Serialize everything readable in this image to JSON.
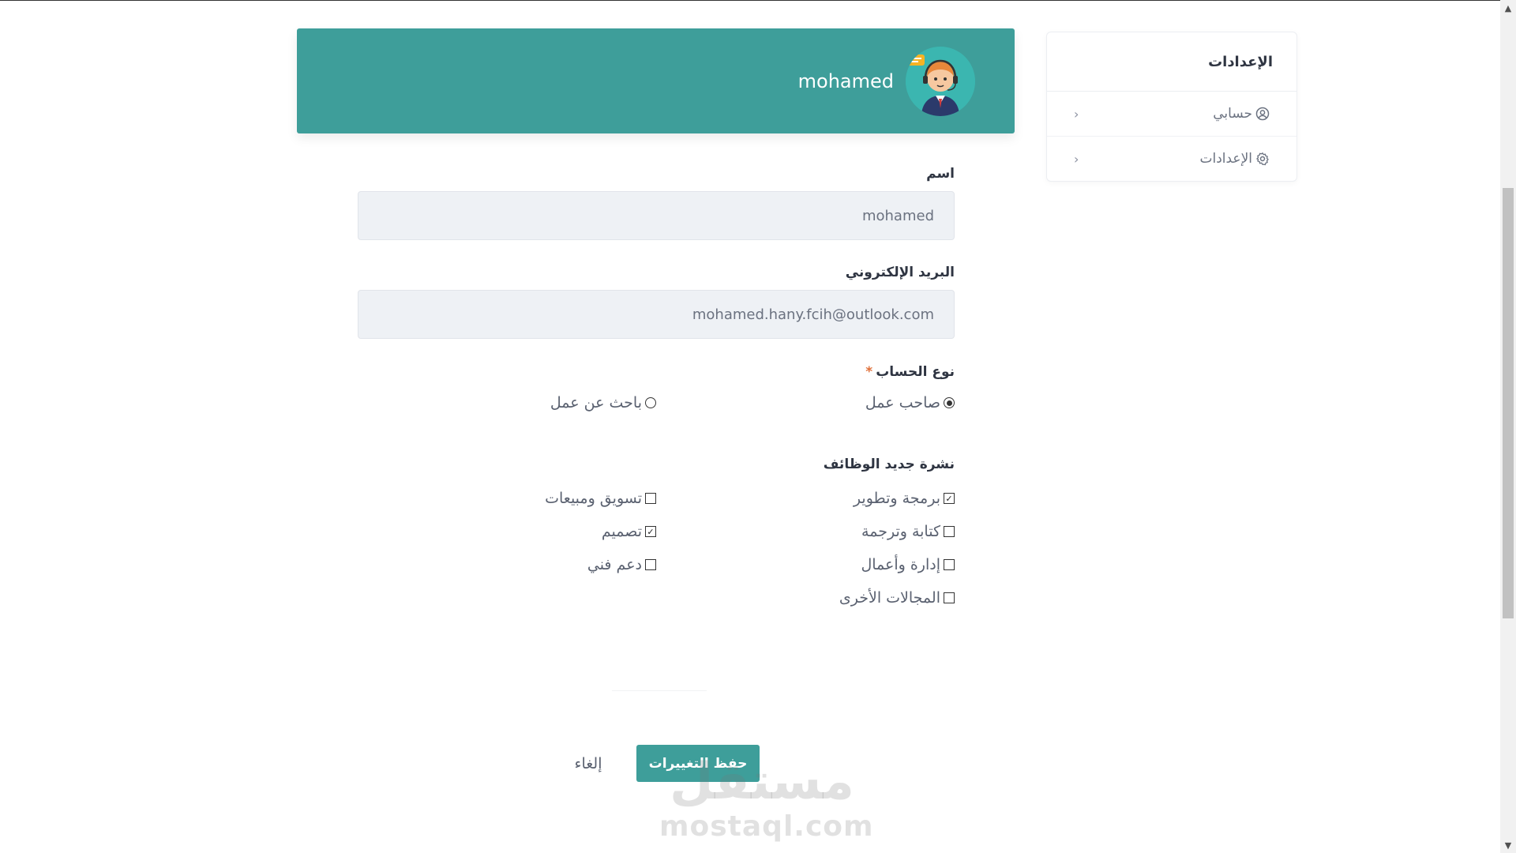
{
  "sidebar": {
    "title": "الإعدادات",
    "items": [
      {
        "label": "حسابي",
        "icon": "user-circle-icon"
      },
      {
        "label": "الإعدادات",
        "icon": "gear-icon"
      }
    ]
  },
  "profile": {
    "name": "mohamed",
    "avatar": "support-agent-avatar"
  },
  "form": {
    "name_label": "اسم",
    "name_value": "mohamed",
    "email_label": "البريد الإلكتروني",
    "email_value": "mohamed.hany.fcih@outlook.com",
    "account_type_label": "نوع الحساب",
    "required_mark": "*",
    "account_types": [
      {
        "label": "صاحب عمل",
        "selected": true
      },
      {
        "label": "باحث عن عمل",
        "selected": false
      }
    ],
    "newsletter_label": "نشرة جديد الوظائف",
    "categories": [
      {
        "label": "برمجة وتطوير",
        "checked": true
      },
      {
        "label": "تسويق ومبيعات",
        "checked": false
      },
      {
        "label": "كتابة وترجمة",
        "checked": false
      },
      {
        "label": "تصميم",
        "checked": true
      },
      {
        "label": "إدارة وأعمال",
        "checked": false
      },
      {
        "label": "دعم فني",
        "checked": false
      },
      {
        "label": "المجالات الأخرى",
        "checked": false
      }
    ]
  },
  "actions": {
    "save_label": "حفظ التغييرات",
    "cancel_label": "إلغاء"
  },
  "watermark": {
    "arabic": "مستقل",
    "latin": "mostaql.com"
  },
  "colors": {
    "accent": "#3e9e9a",
    "input_bg": "#eef1f5"
  }
}
